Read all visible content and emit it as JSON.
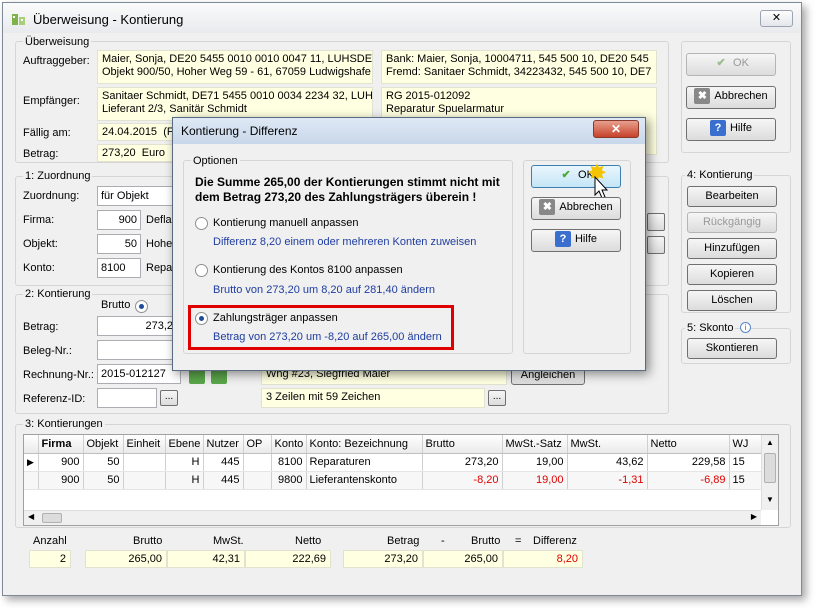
{
  "window": {
    "title": "Überweisung - Kontierung",
    "close": "✕"
  },
  "ueberweisung": {
    "group_label": "Überweisung",
    "auftraggeber_label": "Auftraggeber:",
    "auftraggeber_l1": "Maier, Sonja,  DE20 5455 0010 0010 0047 11,  LUHSDE",
    "auftraggeber_l2": "Objekt 900/50,  Hoher Weg 59 - 61, 67059 Ludwigshafe",
    "auftraggeber_r1": "Bank: Maier, Sonja,  10004711,  545 500 10,  DE20 545",
    "auftraggeber_r2": "Fremd: Sanitaer Schmidt,  34223432,  545 500 10,  DE7",
    "empfaenger_label": "Empfänger:",
    "empfaenger_l1": "Sanitaer Schmidt,  DE71 5455 0010 0034 2234 32,  LUH",
    "empfaenger_l2": "Lieferant 2/3,  Sanitär Schmidt",
    "empfaenger_r1": "RG 2015-012092",
    "empfaenger_r2": "Reparatur Spuelarmatur",
    "faellig_label": "Fällig am:",
    "faellig_value": "24.04.2015",
    "faellig_extra": "(F",
    "betrag_label": "Betrag:",
    "betrag_value": "273,20",
    "betrag_currency": "Euro"
  },
  "side": {
    "ok": "OK",
    "abbrechen": "Abbrechen",
    "hilfe": "Hilfe",
    "kontierung_group": "4: Kontierung",
    "bearbeiten": "Bearbeiten",
    "rueckgaengig": "Rückgängig",
    "hinzufuegen": "Hinzufügen",
    "kopieren": "Kopieren",
    "loeschen": "Löschen",
    "skonto_group": "5: Skonto",
    "skontieren": "Skontieren"
  },
  "zuordnung": {
    "group_label": "1: Zuordnung",
    "zuordnung_label": "Zuordnung:",
    "zuordnung_value": "für Objekt",
    "firma_label": "Firma:",
    "firma_value": "900",
    "firma_name": "Defla",
    "objekt_label": "Objekt:",
    "objekt_value": "50",
    "objekt_name": "Hohe",
    "konto_label": "Konto:",
    "konto_value": "8100",
    "konto_name": "Repa"
  },
  "kontierung2": {
    "group_label": "2: Kontierung",
    "brutto_label": "Brutto",
    "betrag_label": "Betrag:",
    "betrag_value": "273,2",
    "beleg_label": "Beleg-Nr.:",
    "rechnung_label": "Rechnung-Nr.:",
    "rechnung_value": "2015-012127",
    "referenz_label": "Referenz-ID:",
    "wohnung_value": "Whg #23, Siegfried Maier",
    "angleichen": "Angleichen",
    "zeilen_value": "3 Zeilen mit 59 Zeichen",
    "dots": "..."
  },
  "kontierungen": {
    "group_label": "3: Kontierungen",
    "columns": [
      "Firma",
      "Objekt",
      "Einheit",
      "Ebene",
      "Nutzer",
      "OP",
      "Konto",
      "Konto: Bezeichnung",
      "Brutto",
      "MwSt.-Satz",
      "MwSt.",
      "Netto",
      "WJ"
    ],
    "rows": [
      [
        "900",
        "50",
        "",
        "H",
        "445",
        "8100",
        "Reparaturen",
        "273,20",
        "19,00",
        "43,62",
        "229,58",
        "15"
      ],
      [
        "900",
        "50",
        "",
        "H",
        "445",
        "9800",
        "Lieferantenskonto",
        "-8,20",
        "19,00",
        "-1,31",
        "-6,89",
        "15"
      ]
    ]
  },
  "summary": {
    "anzahl_label": "Anzahl",
    "brutto_label": "Brutto",
    "mwst_label": "MwSt.",
    "netto_label": "Netto",
    "betrag_label": "Betrag",
    "minus": "-",
    "brutto2_label": "Brutto",
    "equals": "=",
    "differenz_label": "Differenz",
    "anzahl": "2",
    "brutto": "265,00",
    "mwst": "42,31",
    "netto": "222,69",
    "betrag": "273,20",
    "brutto2": "265,00",
    "differenz": "8,20"
  },
  "dialog": {
    "title": "Kontierung - Differenz",
    "close": "✕",
    "group_label": "Optionen",
    "message_l1": "Die Summe 265,00 der Kontierungen stimmt nicht mit",
    "message_l2": "dem Betrag 273,20 des Zahlungsträgers überein !",
    "opt1_label": "Kontierung manuell anpassen",
    "opt1_desc": "Differenz 8,20 einem oder mehreren Konten zuweisen",
    "opt2_label": "Kontierung des Kontos 8100 anpassen",
    "opt2_desc": "Brutto von 273,20 um 8,20 auf 281,40 ändern",
    "opt3_label": "Zahlungsträger anpassen",
    "opt3_desc": "Betrag von 273,20 um -8,20 auf 265,00 ändern",
    "ok": "OK",
    "abbrechen": "Abbrechen",
    "hilfe": "Hilfe"
  },
  "colors": {
    "highlight": "#e00000",
    "input_yellow": "#ffffe1",
    "dialog_blue": "#1f3da0"
  }
}
